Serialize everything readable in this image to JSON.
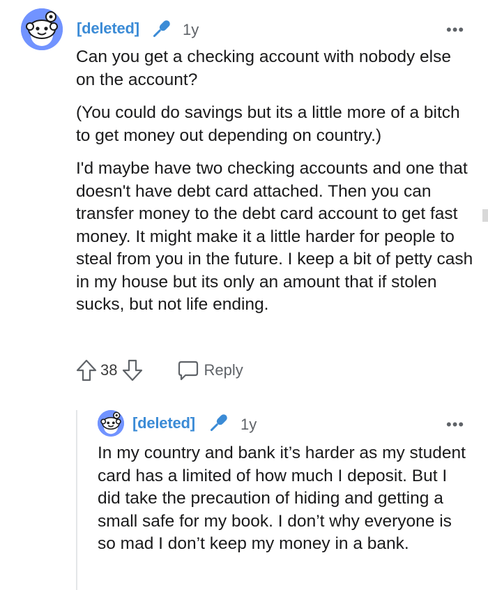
{
  "comment": {
    "author": "[deleted]",
    "age": "1y",
    "more_label": "•••",
    "paragraphs": [
      "Can you get a checking account with nobody else on the account?",
      "(You could do savings but its a little more of a bitch to get money out depending on country.)",
      "I'd maybe have two checking accounts and one that doesn't have debt card attached. Then you can transfer money to the debt card account to get fast money. It might make it a little harder for people to steal from you in the future. I keep a bit of petty cash in my house but its only an amount that if stolen sucks, but not life ending."
    ],
    "votes": "38",
    "reply_label": "Reply"
  },
  "reply": {
    "author": "[deleted]",
    "age": "1y",
    "more_label": "•••",
    "text": "In my country and bank it’s harder as my student card has a limited of how much I deposit. But I did take the precaution of hiding and getting a small safe for my book. I don’t why everyone is so mad I don’t keep my money in a bank."
  },
  "colors": {
    "username": "#3b8bd6",
    "avatar_bg": "#7193ff",
    "meta": "#5f6368"
  },
  "icons": [
    "snoo-avatar-icon",
    "microphone-icon",
    "more-options-icon",
    "upvote-icon",
    "downvote-icon",
    "comment-bubble-icon"
  ]
}
